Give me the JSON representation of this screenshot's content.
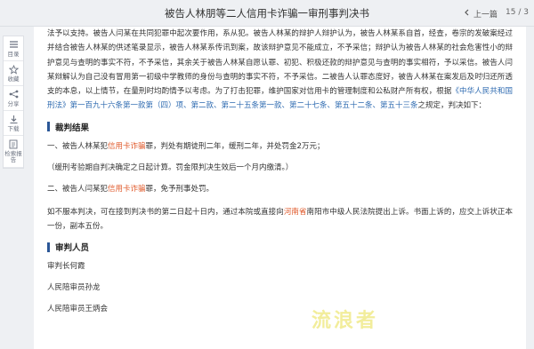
{
  "header": {
    "title": "被告人林朋等二人信用卡诈骗一审刑事判决书",
    "prev_label": "上一篇",
    "pager": "15 / 3"
  },
  "sidebar": {
    "items": [
      {
        "label": "目录",
        "icon": "list-icon"
      },
      {
        "label": "收藏",
        "icon": "star-icon"
      },
      {
        "label": "分享",
        "icon": "share-icon"
      },
      {
        "label": "下载",
        "icon": "download-icon"
      },
      {
        "label": "检索报告",
        "icon": "report-icon"
      }
    ]
  },
  "body": {
    "p1_text": "法予以支持。被告人闫某在共同犯罪中起次要作用，系从犯。被告人林某的辩护人辩护认为，被告人林某系自首，经查，卷宗的发破案经过并结合被告人林某的供述笔录显示，被告人林某系传讯到案，故该辩护意见不能成立，不予采信；辩护认为被告人林某的社会危害性小的辩护意见与查明的事实不符，不予采信，其余关于被告人林某自愿认罪、初犯、积极还款的辩护意见与查明的事实相符，予以采信。被告人闫某辩解认为自己没有冒用第一初级中学教师的身份与查明的事实不符，不予采信。二被告人认罪态度好，被告人林某在案发后及时归还所透支的本息，以上情节，在量刑时均酌情予以考虑。为了打击犯罪，维护国家对信用卡的管理制度和公私财产所有权，根据",
    "law_link": "《中华人民共和国刑法》第一百九十六条第一款第（四）项、第二款、第二十五条第一款、第二十七条、第五十二条、第五十三条",
    "p1_tail": "之规定，判决如下：",
    "section1": "裁判结果",
    "r1_pre": "一、被告人林某犯",
    "r1_crime": "信用卡诈骗",
    "r1_post": "罪，判处有期徒刑二年，缓刑二年，并处罚金2万元；",
    "r1_note": "（缓刑考验期自判决确定之日起计算。罚金限判决生效后一个月内缴清。）",
    "r2_pre": "二、被告人闫某犯",
    "r2_crime": "信用卡诈骗",
    "r2_post": "罪，免予刑事处罚。",
    "appeal_pre": "如不服本判决，可在接到判决书的第二日起十日内，通过本院或直接向",
    "appeal_place": "河南省",
    "appeal_post": "南阳市中级人民法院提出上诉。书面上诉的，应交上诉状正本一份，副本五份。",
    "section2": "审判人员",
    "judge1": "审判长何霞",
    "judge2": "人民陪审员孙龙",
    "judge3": "人民陪审员王炳会"
  },
  "watermark": "流浪者",
  "colors": {
    "link": "#2d6ab0",
    "highlight": "#e05a2b",
    "section_bar": "#2b5797",
    "watermark": "#e9df4a"
  }
}
